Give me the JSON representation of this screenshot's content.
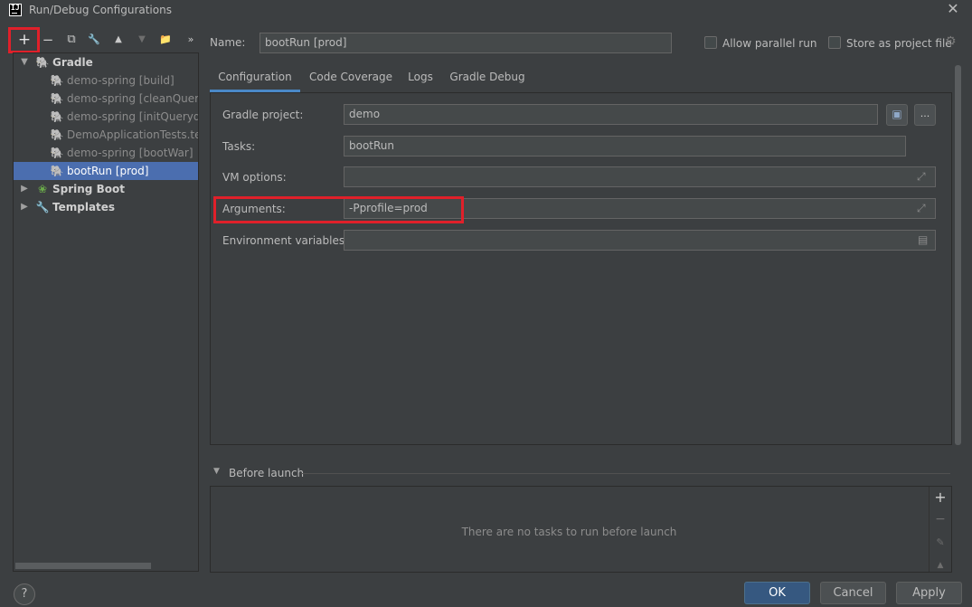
{
  "window": {
    "title": "Run/Debug Configurations",
    "app_icon_text": "IJ",
    "close_glyph": "✕"
  },
  "toolbar": {
    "add": "+",
    "remove": "−",
    "copy": "⧉",
    "edit": "🔧",
    "move_up": "▲",
    "move_down": "▼",
    "new_folder": "📁",
    "more": "»"
  },
  "tree": {
    "gradle_label": "Gradle",
    "gradle_items": [
      "demo-spring [build]",
      "demo-spring [cleanQueryd",
      "demo-spring [initQuerydslS",
      "DemoApplicationTests.test",
      "demo-spring [bootWar]",
      "bootRun [prod]"
    ],
    "spring_boot_label": "Spring Boot",
    "templates_label": "Templates"
  },
  "name_row": {
    "label": "Name:",
    "value": "bootRun [prod]",
    "allow_parallel": "Allow parallel run",
    "store_as_file": "Store as project file"
  },
  "tabs": [
    "Configuration",
    "Code Coverage",
    "Logs",
    "Gradle Debug"
  ],
  "form": {
    "gradle_project_label": "Gradle project:",
    "gradle_project_value": "demo",
    "browse_label": "...",
    "tasks_label": "Tasks:",
    "tasks_value": "bootRun",
    "vm_options_label": "VM options:",
    "vm_options_value": "",
    "arguments_label": "Arguments:",
    "arguments_value": "-Pprofile=prod",
    "env_label": "Environment variables:",
    "env_value": ""
  },
  "before_launch": {
    "title": "Before launch",
    "empty_text": "There are no tasks to run before launch"
  },
  "footer": {
    "help": "?",
    "ok": "OK",
    "cancel": "Cancel",
    "apply": "Apply"
  },
  "colors": {
    "background": "#3c3f41",
    "selection": "#4b6eaf",
    "tab_underline": "#4a88c7",
    "highlight_box": "#e0202a",
    "primary_button": "#365880"
  }
}
